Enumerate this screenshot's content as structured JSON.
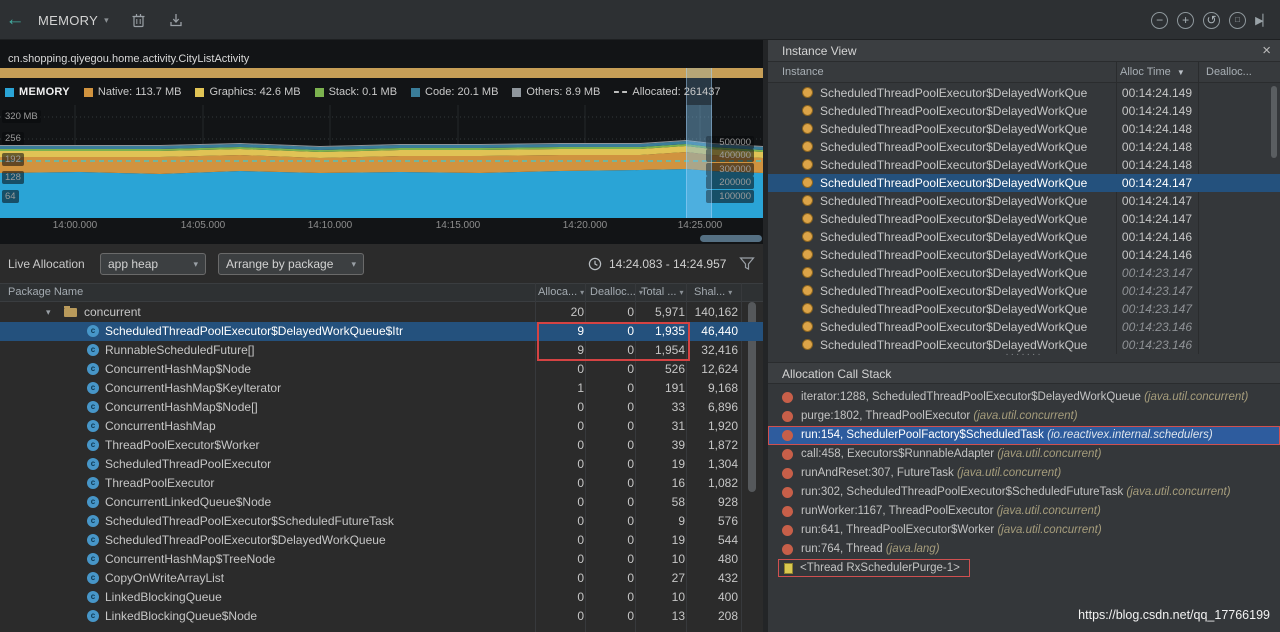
{
  "toolbar": {
    "session_label": "MEMORY",
    "icons": {
      "back": "←",
      "dropdown_caret": "▾",
      "zoom_out": "−",
      "zoom_in": "+",
      "reset_zoom": "↺",
      "zoom_frame": "□",
      "go_live": "▶▏"
    }
  },
  "timeline": {
    "activity": "cn.shopping.qiyegou.home.activity.CityListActivity",
    "legend": {
      "title": "MEMORY",
      "title_color": "#2aa4d6",
      "items": [
        {
          "label": "Native:",
          "value": "113.7 MB",
          "color": "#d0933f"
        },
        {
          "label": "Graphics:",
          "value": "42.6 MB",
          "color": "#e0c355"
        },
        {
          "label": "Stack:",
          "value": "0.1 MB",
          "color": "#7cb24f"
        },
        {
          "label": "Code:",
          "value": "20.1 MB",
          "color": "#3a7d99"
        },
        {
          "label": "Others:",
          "value": "8.9 MB",
          "color": "#8f969c"
        },
        {
          "label": "Allocated:",
          "value": "261437",
          "color": "#bdbdbd",
          "dashed": true
        }
      ]
    },
    "y_left": [
      "320 MB",
      "256",
      "192",
      "128",
      "64"
    ],
    "y_right": [
      "500000",
      "400000",
      "300000",
      "200000",
      "100000"
    ],
    "x_ticks": [
      "14:00.000",
      "14:05.000",
      "14:10.000",
      "14:15.000",
      "14:20.000",
      "14:25.000"
    ]
  },
  "alloc_controls": {
    "live_label": "Live Allocation",
    "heap_select": "app heap",
    "arrange_select": "Arrange by package",
    "time_range": "14:24.083 - 14:24.957"
  },
  "table": {
    "headers": [
      "Package Name",
      "Alloca...",
      "Dealloc...",
      "Total ...",
      "Shal..."
    ],
    "header_caret": "▾",
    "expander_glyph": "▾",
    "class_icon_glyph": "c",
    "rows": [
      {
        "name": "concurrent",
        "type": "package",
        "alloc": "20",
        "dealloc": "0",
        "total": "5,971",
        "shallow": "140,162"
      },
      {
        "name": "ScheduledThreadPoolExecutor$DelayedWorkQueue$Itr",
        "type": "class",
        "selected": true,
        "alloc": "9",
        "dealloc": "0",
        "total": "1,935",
        "shallow": "46,440"
      },
      {
        "name": "RunnableScheduledFuture[]",
        "type": "class",
        "alloc": "9",
        "dealloc": "0",
        "total": "1,954",
        "shallow": "32,416"
      },
      {
        "name": "ConcurrentHashMap$Node",
        "type": "class",
        "alloc": "0",
        "dealloc": "0",
        "total": "526",
        "shallow": "12,624"
      },
      {
        "name": "ConcurrentHashMap$KeyIterator",
        "type": "class",
        "alloc": "1",
        "dealloc": "0",
        "total": "191",
        "shallow": "9,168"
      },
      {
        "name": "ConcurrentHashMap$Node[]",
        "type": "class",
        "alloc": "0",
        "dealloc": "0",
        "total": "33",
        "shallow": "6,896"
      },
      {
        "name": "ConcurrentHashMap",
        "type": "class",
        "alloc": "0",
        "dealloc": "0",
        "total": "31",
        "shallow": "1,920"
      },
      {
        "name": "ThreadPoolExecutor$Worker",
        "type": "class",
        "alloc": "0",
        "dealloc": "0",
        "total": "39",
        "shallow": "1,872"
      },
      {
        "name": "ScheduledThreadPoolExecutor",
        "type": "class",
        "alloc": "0",
        "dealloc": "0",
        "total": "19",
        "shallow": "1,304"
      },
      {
        "name": "ThreadPoolExecutor",
        "type": "class",
        "alloc": "0",
        "dealloc": "0",
        "total": "16",
        "shallow": "1,082"
      },
      {
        "name": "ConcurrentLinkedQueue$Node",
        "type": "class",
        "alloc": "0",
        "dealloc": "0",
        "total": "58",
        "shallow": "928"
      },
      {
        "name": "ScheduledThreadPoolExecutor$ScheduledFutureTask",
        "type": "class",
        "alloc": "0",
        "dealloc": "0",
        "total": "9",
        "shallow": "576"
      },
      {
        "name": "ScheduledThreadPoolExecutor$DelayedWorkQueue",
        "type": "class",
        "alloc": "0",
        "dealloc": "0",
        "total": "19",
        "shallow": "544"
      },
      {
        "name": "ConcurrentHashMap$TreeNode",
        "type": "class",
        "alloc": "0",
        "dealloc": "0",
        "total": "10",
        "shallow": "480"
      },
      {
        "name": "CopyOnWriteArrayList",
        "type": "class",
        "alloc": "0",
        "dealloc": "0",
        "total": "27",
        "shallow": "432"
      },
      {
        "name": "LinkedBlockingQueue",
        "type": "class",
        "alloc": "0",
        "dealloc": "0",
        "total": "10",
        "shallow": "400"
      },
      {
        "name": "LinkedBlockingQueue$Node",
        "type": "class",
        "alloc": "0",
        "dealloc": "0",
        "total": "13",
        "shallow": "208"
      }
    ]
  },
  "instance_view": {
    "title": "Instance View",
    "close_glyph": "×",
    "sort_caret": "▼",
    "splitter_dots": "·······",
    "columns": [
      "Instance",
      "Alloc Time",
      "Dealloc..."
    ],
    "row_label": "ScheduledThreadPoolExecutor$DelayedWorkQue",
    "rows": [
      {
        "time": "00:14:24.149"
      },
      {
        "time": "00:14:24.149"
      },
      {
        "time": "00:14:24.148"
      },
      {
        "time": "00:14:24.148"
      },
      {
        "time": "00:14:24.148"
      },
      {
        "time": "00:14:24.147",
        "selected": true
      },
      {
        "time": "00:14:24.147"
      },
      {
        "time": "00:14:24.147"
      },
      {
        "time": "00:14:24.146"
      },
      {
        "time": "00:14:24.146"
      },
      {
        "time": "00:14:23.147",
        "deallocated": true
      },
      {
        "time": "00:14:23.147",
        "deallocated": true
      },
      {
        "time": "00:14:23.147",
        "deallocated": true
      },
      {
        "time": "00:14:23.146",
        "deallocated": true
      },
      {
        "time": "00:14:23.146",
        "deallocated": true
      }
    ]
  },
  "call_stack": {
    "title": "Allocation Call Stack",
    "frames": [
      {
        "sig": "iterator:1288, ScheduledThreadPoolExecutor$DelayedWorkQueue",
        "pkg": "(java.util.concurrent)"
      },
      {
        "sig": "purge:1802, ThreadPoolExecutor",
        "pkg": "(java.util.concurrent)"
      },
      {
        "sig": "run:154, SchedulerPoolFactory$ScheduledTask",
        "pkg": "(io.reactivex.internal.schedulers)",
        "selected": true,
        "outlined": true
      },
      {
        "sig": "call:458, Executors$RunnableAdapter",
        "pkg": "(java.util.concurrent)"
      },
      {
        "sig": "runAndReset:307, FutureTask",
        "pkg": "(java.util.concurrent)"
      },
      {
        "sig": "run:302, ScheduledThreadPoolExecutor$ScheduledFutureTask",
        "pkg": "(java.util.concurrent)"
      },
      {
        "sig": "runWorker:1167, ThreadPoolExecutor",
        "pkg": "(java.util.concurrent)"
      },
      {
        "sig": "run:641, ThreadPoolExecutor$Worker",
        "pkg": "(java.util.concurrent)"
      },
      {
        "sig": "run:764, Thread",
        "pkg": "(java.lang)"
      },
      {
        "sig": "<Thread RxSchedulerPurge-1>",
        "pkg": "",
        "thread": true,
        "outlined": true
      }
    ]
  },
  "watermark": "https://blog.csdn.net/qq_17766199"
}
